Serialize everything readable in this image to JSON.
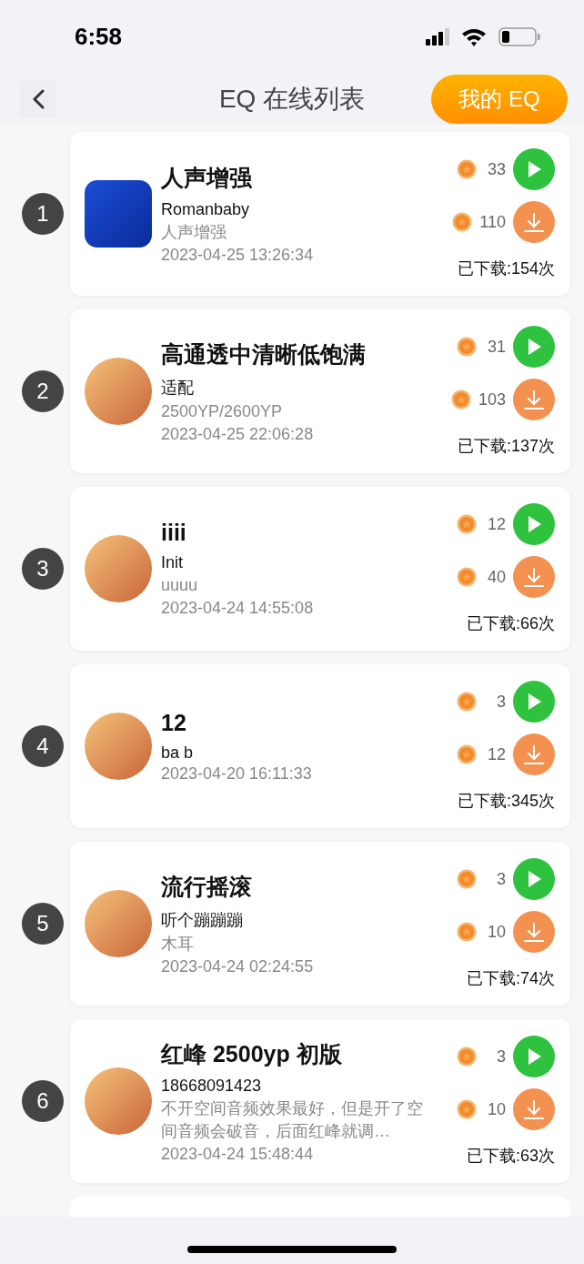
{
  "status_bar": {
    "time": "6:58"
  },
  "nav": {
    "title": "EQ 在线列表",
    "action": "我的 EQ"
  },
  "items": [
    {
      "rank": "1",
      "kind": "square",
      "title": "人声增强",
      "author": "Romanbaby",
      "description": "人声增强",
      "date": "2023-04-25 13:26:34",
      "listen_price": "33",
      "download_price": "110",
      "downloads": "已下载:154次"
    },
    {
      "rank": "2",
      "kind": "circle",
      "title": "高通透中清晰低饱满",
      "author": "适配",
      "description": "2500YP/2600YP",
      "date": "2023-04-25 22:06:28",
      "listen_price": "31",
      "download_price": "103",
      "downloads": "已下载:137次"
    },
    {
      "rank": "3",
      "kind": "circle",
      "title": "iiii",
      "author": "Init",
      "description": "uuuu",
      "date": "2023-04-24 14:55:08",
      "listen_price": "12",
      "download_price": "40",
      "downloads": "已下载:66次"
    },
    {
      "rank": "4",
      "kind": "circle",
      "title": "12",
      "author": "ba b",
      "date": "2023-04-20 16:11:33",
      "listen_price": "3",
      "download_price": "12",
      "downloads": "已下载:345次"
    },
    {
      "rank": "5",
      "kind": "circle",
      "title": "流行摇滚",
      "author": "听个蹦蹦蹦",
      "description": "木耳",
      "date": "2023-04-24 02:24:55",
      "listen_price": "3",
      "download_price": "10",
      "downloads": "已下载:74次"
    },
    {
      "rank": "6",
      "kind": "circle",
      "title": "红峰 2500yp 初版",
      "author": "18668091423",
      "description": "不开空间音频效果最好，但是开了空间音频会破音，后面红峰就调…",
      "date": "2023-04-24 15:48:44",
      "listen_price": "3",
      "download_price": "10",
      "downloads": "已下载:63次"
    }
  ]
}
